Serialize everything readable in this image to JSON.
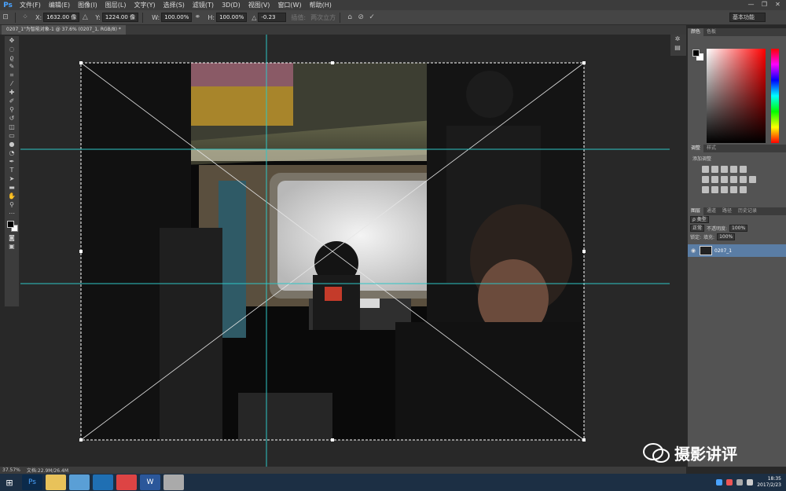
{
  "app": {
    "logo": "Ps"
  },
  "menu": [
    "文件(F)",
    "编辑(E)",
    "图像(I)",
    "图层(L)",
    "文字(Y)",
    "选择(S)",
    "滤镜(T)",
    "3D(D)",
    "视图(V)",
    "窗口(W)",
    "帮助(H)"
  ],
  "options": {
    "x_label": "X:",
    "x_value": "1632.00 像",
    "y_label": "Y:",
    "y_value": "1224.00 像",
    "w_label": "W:",
    "w_value": "100.00%",
    "h_label": "H:",
    "h_value": "100.00%",
    "angle_label": "△",
    "angle_value": "-0.23",
    "interp_label": "插值:",
    "warp_label": "两次立方",
    "workspace": "基本功能"
  },
  "document": {
    "tab_title": "0207_1\"为智能对象-1 @ 37.6% (0207_1, RGB/8) *"
  },
  "status": {
    "zoom": "37.57%",
    "doc": "文档:22.9M/26.4M"
  },
  "panels": {
    "color_tabs": [
      "颜色",
      "色板"
    ],
    "adjust_tabs": [
      "调整",
      "样式"
    ],
    "adjust_title": "添加调整",
    "layers_tabs": [
      "图层",
      "通道",
      "路径",
      "历史记录"
    ],
    "kind": "ρ 类型",
    "blend": "正常",
    "opacity_label": "不透明度:",
    "opacity": "100%",
    "lock_label": "锁定:",
    "fill_label": "填充:",
    "fill": "100%",
    "layer_name": "0207_1"
  },
  "watermark": "摄影讲评",
  "taskbar": {
    "time": "18:35",
    "date": "2017/2/23"
  },
  "colors": {
    "guide": "#2ec6c6",
    "accent": "#4aa3ff",
    "selection": "#5a7da5"
  }
}
